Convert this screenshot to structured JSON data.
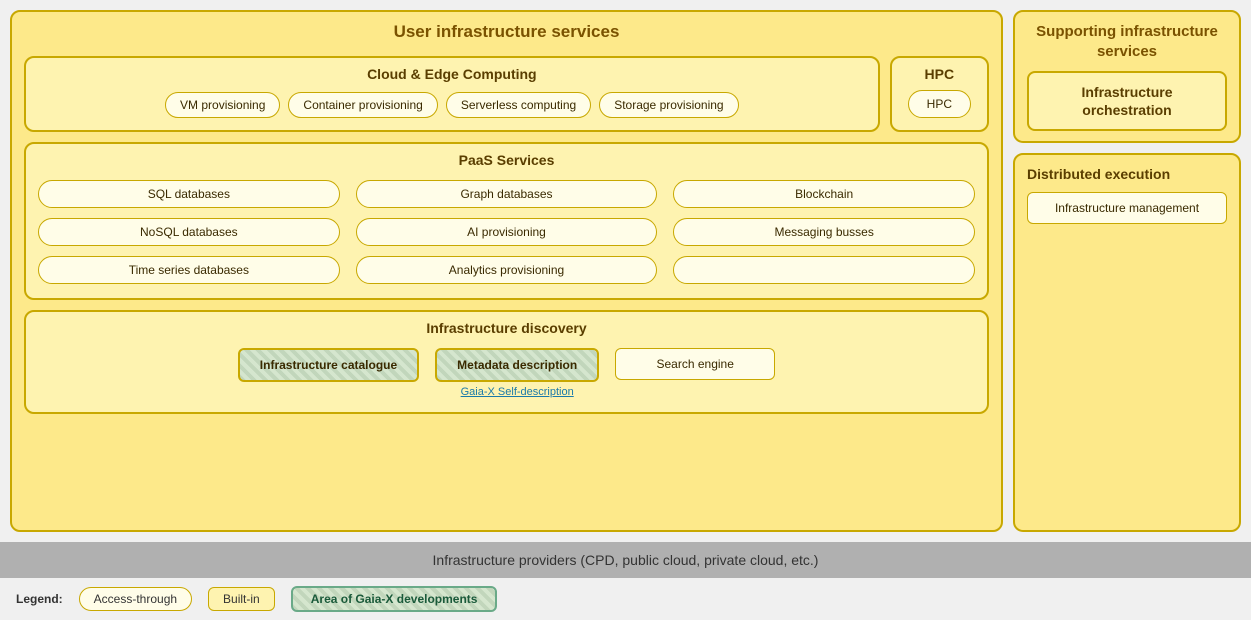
{
  "leftPanel": {
    "title": "User infrastructure services",
    "cloudEdge": {
      "title": "Cloud & Edge Computing",
      "chips": [
        "VM provisioning",
        "Container provisioning",
        "Serverless computing",
        "Storage provisioning"
      ]
    },
    "hpc": {
      "title": "HPC",
      "chip": "HPC"
    },
    "paas": {
      "title": "PaaS Services",
      "items": [
        "SQL databases",
        "Graph databases",
        "Blockchain",
        "NoSQL databases",
        "AI provisioning",
        "Messaging busses",
        "Time series databases",
        "Analytics provisioning",
        ""
      ]
    },
    "discovery": {
      "title": "Infrastructure discovery",
      "catalogue": "Infrastructure catalogue",
      "metadata": "Metadata description",
      "gaiaX": "Gaia-X Self-description",
      "search": "Search engine"
    }
  },
  "rightPanel": {
    "supporting": {
      "title": "Supporting infrastructure services",
      "orchTitle": "Infrastructure orchestration"
    },
    "distributed": {
      "title": "Distributed execution",
      "mgmt": "Infrastructure management"
    }
  },
  "bottomBar": {
    "text": "Infrastructure providers (CPD, public cloud, private cloud, etc.)"
  },
  "legend": {
    "label": "Legend:",
    "access": "Access-through",
    "builtin": "Built-in",
    "gaiax": "Area of Gaia-X developments"
  }
}
